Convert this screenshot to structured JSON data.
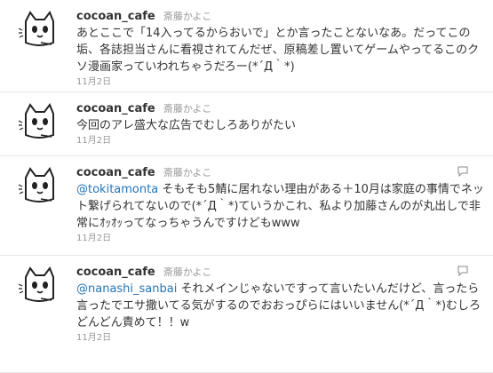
{
  "tweets": [
    {
      "screen_name": "cocoan_cafe",
      "full_name": "斎藤かよこ",
      "mention": "",
      "text": "あとここで「14入ってるからおいで」とか言ったことないなあ。だってこの垢、各誌担当さんに看視されてんだぜ、原稿差し置いてゲームやってるこのクソ漫画家っていわれちゃうだろー(*´Д｀*)",
      "time": "11月2日"
    },
    {
      "screen_name": "cocoan_cafe",
      "full_name": "斎藤かよこ",
      "mention": "",
      "text": "今回のアレ盛大な広告でむしろありがたい",
      "time": "11月2日"
    },
    {
      "screen_name": "cocoan_cafe",
      "full_name": "斎藤かよこ",
      "mention": "@tokitamonta",
      "text": " そもそも5鯖に居れない理由がある＋10月は家庭の事情でネット繋げられてないので(*´Д｀*)ていうかこれ、私より加藤さんのが丸出しで非常にｵｯｵｯってなっちゃうんですけどもwww",
      "time": "11月2日"
    },
    {
      "screen_name": "cocoan_cafe",
      "full_name": "斎藤かよこ",
      "mention": "@nanashi_sanbai",
      "text": " それメインじゃないですって言いたいんだけど、言ったら言ったでエサ撒いてる気がするのでおおっぴらにはいいません(*´Д｀*)むしろどんどん責めて！！w",
      "time": "11月2日"
    }
  ],
  "icons": {
    "avatar": "cat-avatar-icon",
    "reply": "reply-icon"
  },
  "colors": {
    "link": "#2276bb",
    "meta": "#999999",
    "divider": "#e6e6e6"
  }
}
